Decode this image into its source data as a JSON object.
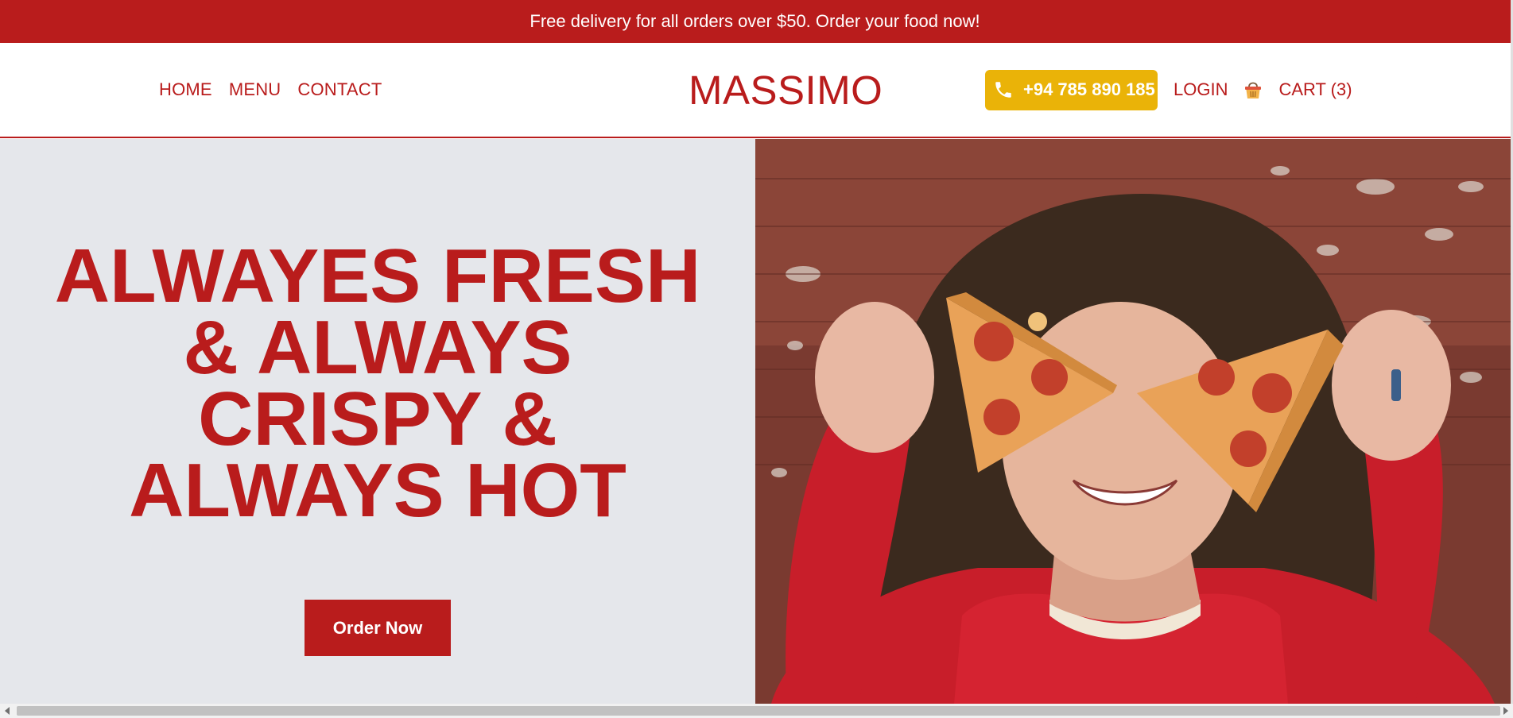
{
  "banner": {
    "text": "Free delivery for all orders over $50. Order your food now!"
  },
  "nav": {
    "links": [
      "HOME",
      "MENU",
      "CONTACT"
    ],
    "logo": "MASSIMO",
    "phone": "+94 785 890 185",
    "login": "LOGIN",
    "cart": "CART (3)"
  },
  "hero": {
    "headline_lines": [
      "ALWAYES FRESH",
      "& ALWAYS",
      "CRISPY &",
      "ALWAYS HOT"
    ],
    "cta": "Order Now"
  },
  "colors": {
    "brand_red": "#b91c1c",
    "phone_yellow": "#eab308",
    "hero_bg": "#e5e7eb"
  },
  "icons": [
    "phone-icon",
    "cart-basket-icon"
  ]
}
